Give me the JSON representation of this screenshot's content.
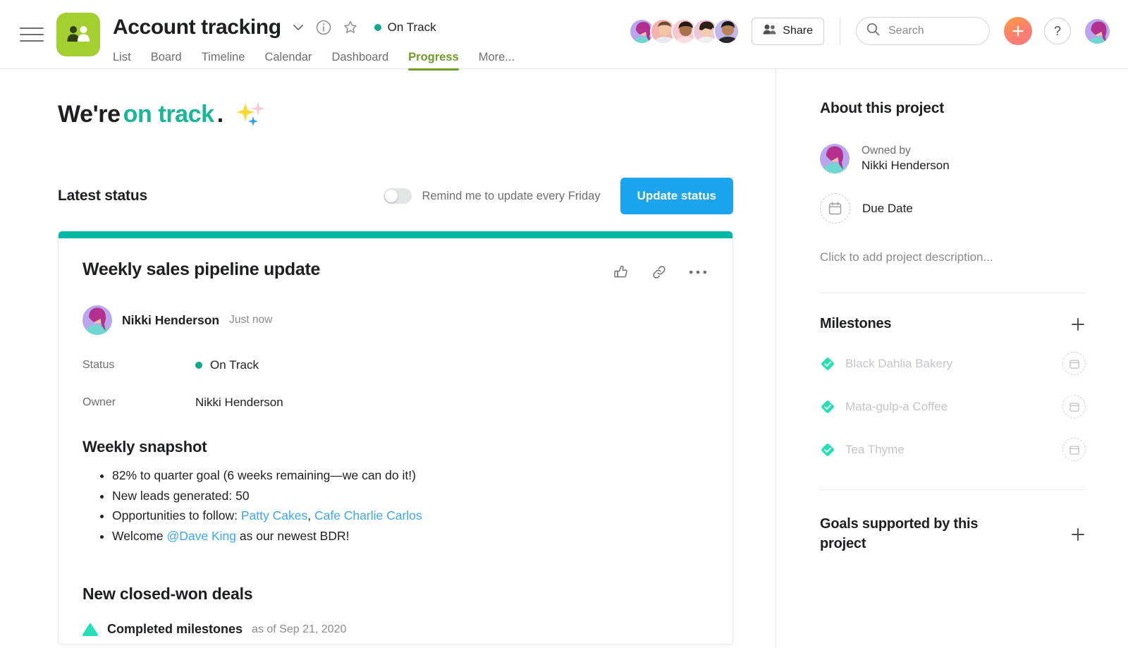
{
  "header": {
    "menu_label": "menu",
    "project_title": "Account tracking",
    "status_label": "On Track",
    "tabs": [
      {
        "label": "List",
        "active": false
      },
      {
        "label": "Board",
        "active": false
      },
      {
        "label": "Timeline",
        "active": false
      },
      {
        "label": "Calendar",
        "active": false
      },
      {
        "label": "Dashboard",
        "active": false
      },
      {
        "label": "Progress",
        "active": true
      },
      {
        "label": "More...",
        "active": false
      }
    ],
    "share_label": "Share",
    "search_placeholder": "Search",
    "search_value": "",
    "help_label": "?",
    "accent_green": "#6f9b26",
    "project_icon_bg": "#a4cf30",
    "status_dot_color": "#14a88e",
    "members": [
      {
        "name": "Nikki Henderson",
        "bg": "#b9a6ef"
      },
      {
        "name": "Member 2",
        "bg": "#f3b3ae"
      },
      {
        "name": "Member 3",
        "bg": "#f6c7cd"
      },
      {
        "name": "Member 4",
        "bg": "#f1c6d4"
      },
      {
        "name": "Member 5",
        "bg": "#c3b6ef"
      }
    ]
  },
  "main": {
    "headline_prefix": "We're ",
    "headline_highlight": "on track",
    "headline_suffix": ".",
    "headline_highlight_color": "#18b79a",
    "latest_status_title": "Latest status",
    "remind_label": "Remind me to update every Friday",
    "remind_enabled": false,
    "update_button": "Update status",
    "update_button_color": "#1ca5ef",
    "card": {
      "strip_color": "#00b9a3",
      "title": "Weekly sales pipeline update",
      "author_name": "Nikki Henderson",
      "author_time": "Just now",
      "fields": [
        {
          "key": "Status",
          "value": "On Track",
          "has_dot": true,
          "dot_color": "#14a88e"
        },
        {
          "key": "Owner",
          "value": "Nikki Henderson",
          "has_dot": false
        }
      ],
      "snapshot_heading": "Weekly snapshot",
      "bullets": [
        {
          "parts": [
            {
              "t": "82% to quarter goal (6 weeks remaining—we can do it!)",
              "link": false
            }
          ]
        },
        {
          "parts": [
            {
              "t": "New leads generated: 50",
              "link": false
            }
          ]
        },
        {
          "parts": [
            {
              "t": "Opportunities to follow: ",
              "link": false
            },
            {
              "t": "Patty Cakes",
              "link": true
            },
            {
              "t": ", ",
              "link": false
            },
            {
              "t": "Cafe Charlie Carlos",
              "link": true
            }
          ]
        },
        {
          "parts": [
            {
              "t": "Welcome ",
              "link": false
            },
            {
              "t": "@Dave King",
              "link": true
            },
            {
              "t": " as our newest BDR!",
              "link": false
            }
          ]
        }
      ],
      "deals_heading": "New closed-won deals",
      "milestone_line_strong": "Completed milestones",
      "milestone_line_light": "as of Sep 21, 2020"
    }
  },
  "sidebar": {
    "about_title": "About this project",
    "owned_by_label": "Owned by",
    "owner_name": "Nikki Henderson",
    "due_date_label": "Due Date",
    "description_placeholder": "Click to add project description...",
    "milestones_title": "Milestones",
    "milestones": [
      {
        "name": "Black Dahlia Bakery",
        "completed": true
      },
      {
        "name": "Mata-gulp-a Coffee",
        "completed": true
      },
      {
        "name": "Tea Thyme",
        "completed": true
      }
    ],
    "goals_title": "Goals supported by this project",
    "milestone_check_color": "#25e0b6"
  }
}
